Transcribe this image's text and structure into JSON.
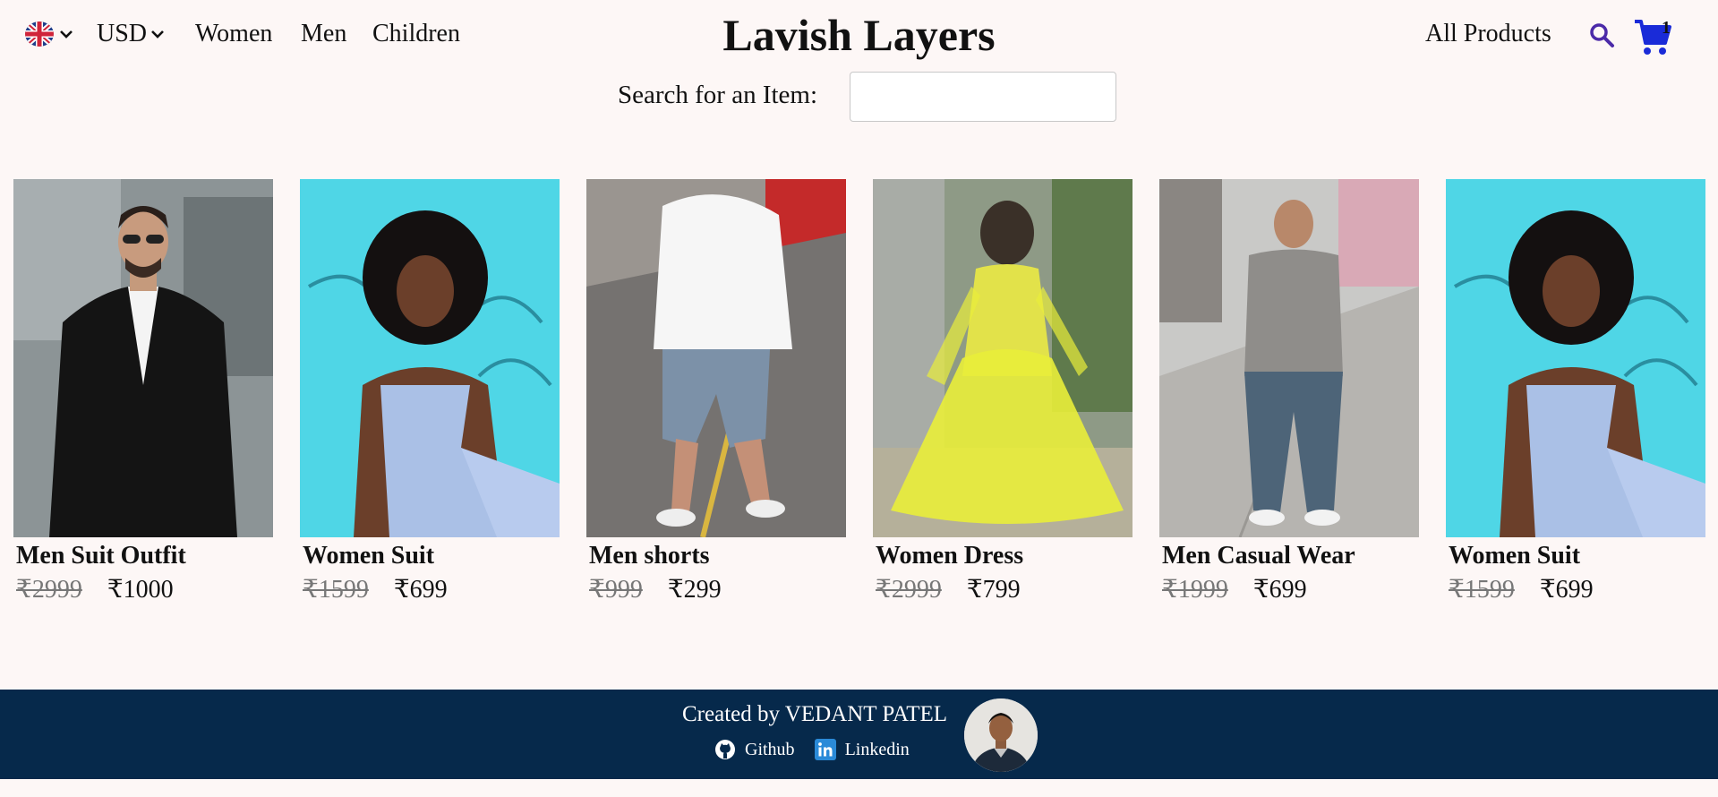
{
  "header": {
    "language_icon": "uk-flag-icon",
    "currency": "USD",
    "nav": [
      "Women",
      "Men",
      "Children"
    ],
    "brand": "Lavish Layers",
    "all_products": "All Products",
    "search_icon": "search-icon",
    "cart_icon": "cart-icon",
    "cart_count": "1"
  },
  "search": {
    "label": "Search for an Item:",
    "value": "",
    "placeholder": ""
  },
  "products": [
    {
      "title": "Men Suit Outfit",
      "old_price": "₹2999",
      "price": "₹1000"
    },
    {
      "title": "Women Suit",
      "old_price": "₹1599",
      "price": "₹699"
    },
    {
      "title": "Men shorts",
      "old_price": "₹999",
      "price": "₹299"
    },
    {
      "title": "Women Dress",
      "old_price": "₹2999",
      "price": "₹799"
    },
    {
      "title": "Men Casual Wear",
      "old_price": "₹1999",
      "price": "₹699"
    },
    {
      "title": "Women Suit",
      "old_price": "₹1599",
      "price": "₹699"
    }
  ],
  "footer": {
    "credit": "Created by VEDANT PATEL",
    "github": "Github",
    "linkedin": "Linkedin"
  },
  "colors": {
    "background": "#fdf7f6",
    "footer_bg": "#06294b",
    "search_icon": "#4b2aa8",
    "cart_icon": "#1a2bd8",
    "old_price": "#777777"
  }
}
